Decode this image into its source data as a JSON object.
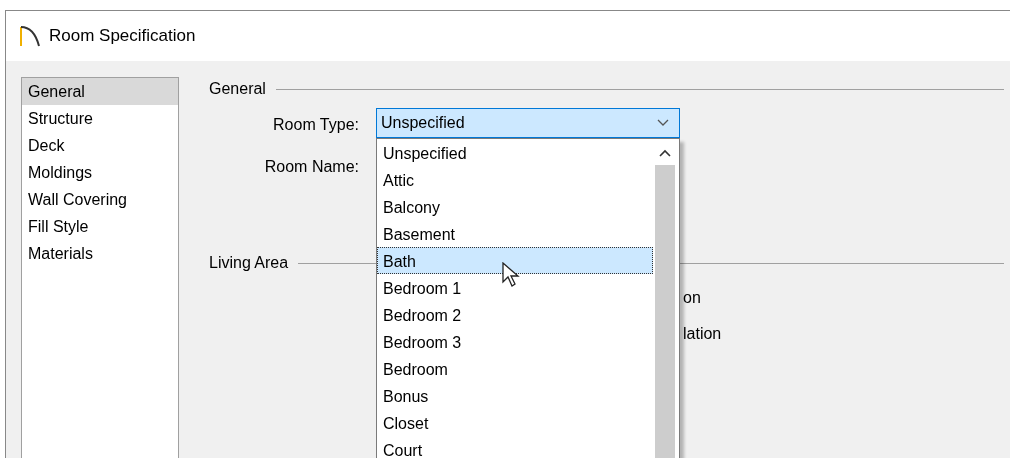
{
  "window": {
    "title": "Room Specification"
  },
  "sidebar": {
    "items": [
      {
        "label": "General",
        "selected": true
      },
      {
        "label": "Structure",
        "selected": false
      },
      {
        "label": "Deck",
        "selected": false
      },
      {
        "label": "Moldings",
        "selected": false
      },
      {
        "label": "Wall Covering",
        "selected": false
      },
      {
        "label": "Fill Style",
        "selected": false
      },
      {
        "label": "Materials",
        "selected": false
      }
    ]
  },
  "general": {
    "heading": "General",
    "room_type": {
      "label": "Room Type:",
      "value": "Unspecified",
      "expanded": true,
      "options": [
        {
          "label": "Unspecified",
          "highlighted": false
        },
        {
          "label": "Attic",
          "highlighted": false
        },
        {
          "label": "Balcony",
          "highlighted": false
        },
        {
          "label": "Basement",
          "highlighted": false
        },
        {
          "label": "Bath",
          "highlighted": true
        },
        {
          "label": "Bedroom 1",
          "highlighted": false
        },
        {
          "label": "Bedroom 2",
          "highlighted": false
        },
        {
          "label": "Bedroom 3",
          "highlighted": false
        },
        {
          "label": "Bedroom",
          "highlighted": false
        },
        {
          "label": "Bonus",
          "highlighted": false
        },
        {
          "label": "Closet",
          "highlighted": false
        },
        {
          "label": "Court",
          "highlighted": false
        }
      ]
    },
    "room_name": {
      "label": "Room Name:"
    }
  },
  "living_area": {
    "heading": "Living Area",
    "partial_texts": [
      "on",
      "lation"
    ]
  }
}
